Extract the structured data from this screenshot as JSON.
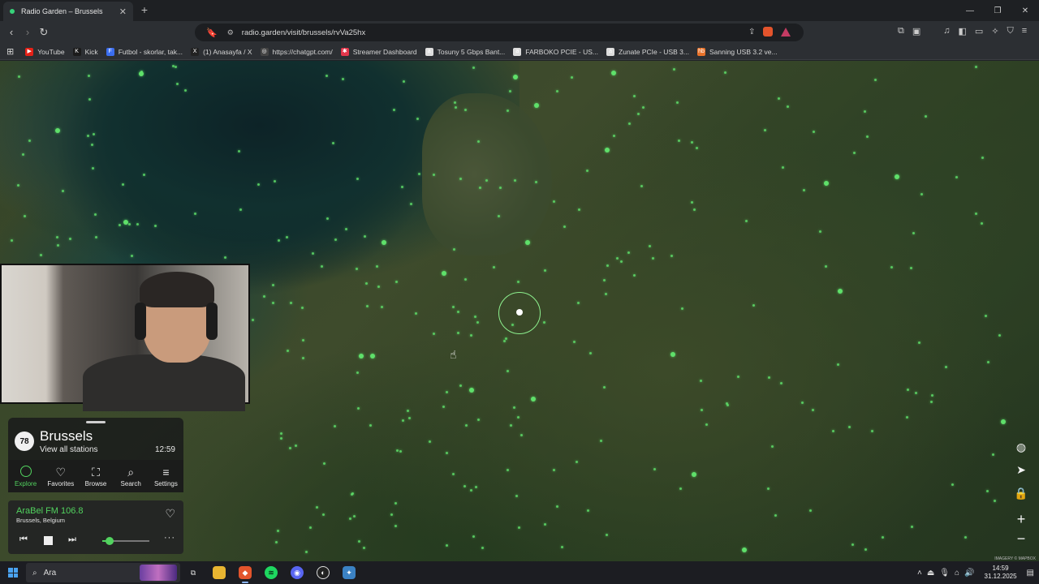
{
  "browser": {
    "tab_title": "Radio Garden – Brussels",
    "tab_close": "✕",
    "new_tab": "+",
    "url": "radio.garden/visit/brussels/rvVa25hx",
    "bookmarks": [
      {
        "label": "YouTube",
        "color": "#e62117",
        "glyph": "▶"
      },
      {
        "label": "Kick",
        "color": "#1b1b1b",
        "glyph": "K"
      },
      {
        "label": "Futbol - skorlar, tak...",
        "color": "#3b6ef0",
        "glyph": "F"
      },
      {
        "label": "(1) Anasayfa / X",
        "color": "#222",
        "glyph": "X"
      },
      {
        "label": "https://chatgpt.com/",
        "color": "#444",
        "glyph": "◎"
      },
      {
        "label": "Streamer Dashboard",
        "color": "#e2364b",
        "glyph": "✱"
      },
      {
        "label": "Tosuny 5 Gbps Bant...",
        "color": "#ddd",
        "glyph": "a"
      },
      {
        "label": "FARBOKO PCIE - US...",
        "color": "#ddd",
        "glyph": "a"
      },
      {
        "label": "Zunate PCIe - USB 3...",
        "color": "#ddd",
        "glyph": "a"
      },
      {
        "label": "Sanning USB 3.2 ve...",
        "color": "#e8722a",
        "glyph": "hb"
      }
    ]
  },
  "panel": {
    "station_count": "78",
    "place": "Brussels",
    "view_all": "View all stations",
    "local_time": "12:59",
    "nav": [
      {
        "label": "Explore",
        "icon": "explore-icon"
      },
      {
        "label": "Favorites",
        "icon": "heart-icon"
      },
      {
        "label": "Browse",
        "icon": "map-icon"
      },
      {
        "label": "Search",
        "icon": "search-icon"
      },
      {
        "label": "Settings",
        "icon": "menu-icon"
      }
    ]
  },
  "player": {
    "station": "AraBel FM 106.8",
    "location": "Brussels, Belgium",
    "volume": 0.15
  },
  "taskbar": {
    "search_placeholder": "Ara",
    "time": "14:59",
    "date": "31.12.2025"
  },
  "map": {
    "attribution": "IMAGERY © MAPBOX",
    "accent": "#5fe06a"
  }
}
